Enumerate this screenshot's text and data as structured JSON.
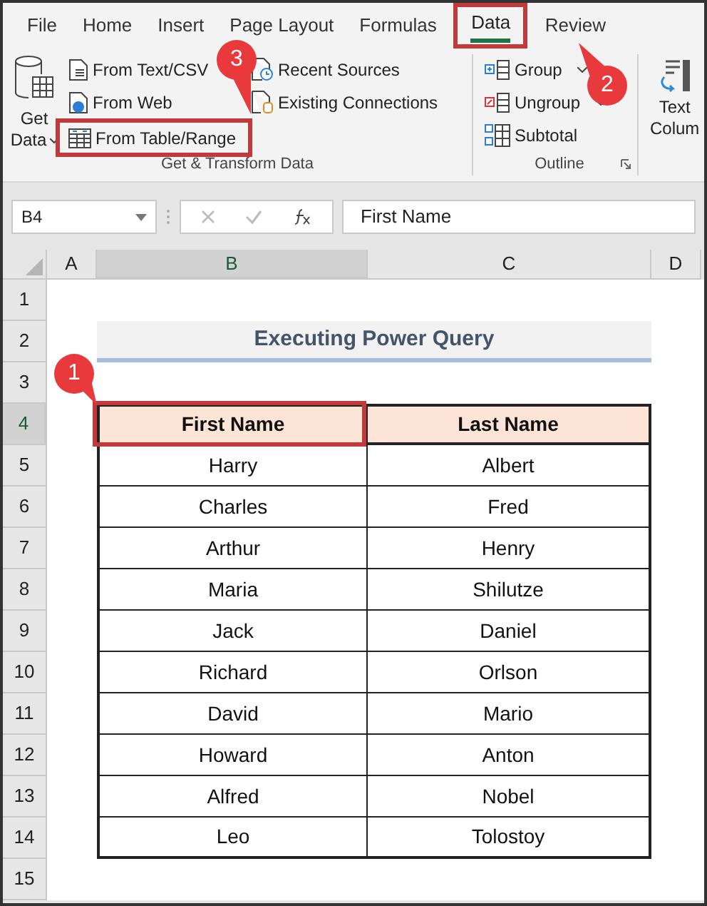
{
  "menu_tabs": [
    {
      "label": "File",
      "selected": false
    },
    {
      "label": "Home",
      "selected": false
    },
    {
      "label": "Insert",
      "selected": false
    },
    {
      "label": "Page Layout",
      "selected": false
    },
    {
      "label": "Formulas",
      "selected": false
    },
    {
      "label": "Data",
      "selected": true
    },
    {
      "label": "Review",
      "selected": false
    }
  ],
  "ribbon": {
    "get_data": {
      "line_1": "Get",
      "line_2": "Data"
    },
    "transform_buttons": [
      {
        "label": "From Text/CSV",
        "kind": "text",
        "highlighted": false
      },
      {
        "label": "From Web",
        "kind": "web",
        "highlighted": false
      },
      {
        "label": "From Table/Range",
        "kind": "table",
        "highlighted": true
      }
    ],
    "source_buttons": [
      {
        "label": "Recent Sources",
        "kind": "recent"
      },
      {
        "label": "Existing Connections",
        "kind": "connections"
      }
    ],
    "transform_group_label": "Get & Transform Data",
    "outline_buttons": [
      {
        "label": "Group",
        "kind": "group"
      },
      {
        "label": "Ungroup",
        "kind": "ungroup"
      },
      {
        "label": "Subtotal",
        "kind": "subtotal"
      }
    ],
    "outline_group_label": "Outline",
    "text_columns": {
      "line_1": "Text",
      "line_2": "Colum"
    }
  },
  "name_box": "B4",
  "formula": "First Name",
  "column_headers": [
    {
      "label": "A",
      "selected": false
    },
    {
      "label": "B",
      "selected": true
    },
    {
      "label": "C",
      "selected": false
    },
    {
      "label": "D",
      "selected": false
    }
  ],
  "row_numbers": [
    {
      "label": "1",
      "selected": false
    },
    {
      "label": "2",
      "selected": false
    },
    {
      "label": "3",
      "selected": false
    },
    {
      "label": "4",
      "selected": true
    },
    {
      "label": "5",
      "selected": false
    },
    {
      "label": "6",
      "selected": false
    },
    {
      "label": "7",
      "selected": false
    },
    {
      "label": "8",
      "selected": false
    },
    {
      "label": "9",
      "selected": false
    },
    {
      "label": "10",
      "selected": false
    },
    {
      "label": "11",
      "selected": false
    },
    {
      "label": "12",
      "selected": false
    },
    {
      "label": "13",
      "selected": false
    },
    {
      "label": "14",
      "selected": false
    },
    {
      "label": "15",
      "selected": false
    }
  ],
  "sheet_title": "Executing Power Query",
  "table": {
    "columns": [
      "First Name",
      "Last Name"
    ],
    "rows": [
      [
        "Harry",
        "Albert"
      ],
      [
        "Charles",
        "Fred"
      ],
      [
        "Arthur",
        "Henry"
      ],
      [
        "Maria",
        "Shilutze"
      ],
      [
        "Jack",
        "Daniel"
      ],
      [
        "Richard",
        "Orlson"
      ],
      [
        "David",
        "Mario"
      ],
      [
        "Howard",
        "Anton"
      ],
      [
        "Alfred",
        "Nobel"
      ],
      [
        "Leo",
        "Tolostoy"
      ]
    ]
  },
  "callouts": [
    "1",
    "2",
    "3"
  ]
}
